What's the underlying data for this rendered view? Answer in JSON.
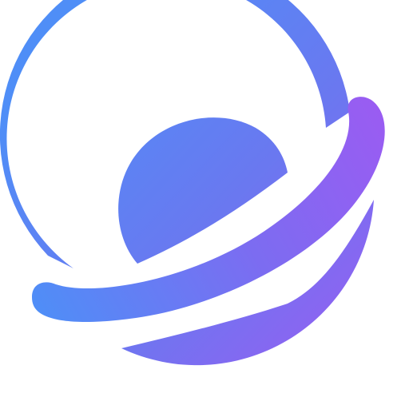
{
  "logo": {
    "icon": "planet-ring-icon",
    "colors": {
      "gradient_start": "#4F8EF7",
      "gradient_mid": "#6A78F0",
      "gradient_end": "#9A5CF2",
      "background": "#FFFFFF"
    }
  }
}
